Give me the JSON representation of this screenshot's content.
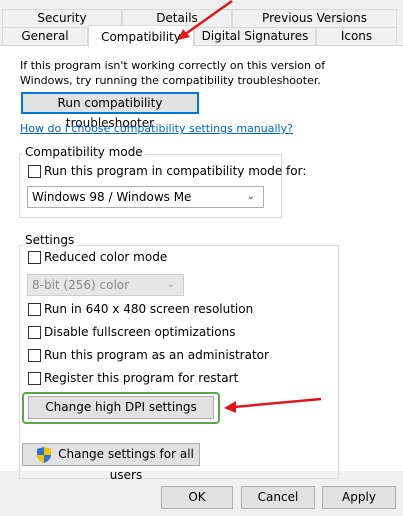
{
  "tabs": {
    "security": "Security",
    "details": "Details",
    "previous_versions": "Previous Versions",
    "general": "General",
    "compatibility": "Compatibility",
    "digital_signatures": "Digital Signatures",
    "icons": "Icons"
  },
  "intro_text": "If this program isn't working correctly on this version of Windows, try running the compatibility troubleshooter.",
  "troubleshooter_button": "Run compatibility troubleshooter",
  "manual_link": "How do I choose compatibility settings manually?",
  "compat_mode": {
    "group_label": "Compatibility mode",
    "checkbox_label": "Run this program in compatibility mode for:",
    "checked": false,
    "selected_os": "Windows 98 / Windows Me"
  },
  "settings": {
    "group_label": "Settings",
    "reduced_color": "Reduced color mode",
    "color_select": "8-bit (256) color",
    "res_640": "Run in 640 x 480 screen resolution",
    "disable_fullscreen": "Disable fullscreen optimizations",
    "run_admin": "Run this program as an administrator",
    "register_restart": "Register this program for restart",
    "high_dpi_button": "Change high DPI settings"
  },
  "all_users_button": "Change settings for all users",
  "footer": {
    "ok": "OK",
    "cancel": "Cancel",
    "apply": "Apply"
  },
  "colors": {
    "annotation_arrow": "#e0161b",
    "highlight_border": "#5aa84a",
    "link": "#0066cc",
    "primary_focus": "#0078d7"
  },
  "icons": {
    "all_users_button": "uac-shield-icon"
  }
}
